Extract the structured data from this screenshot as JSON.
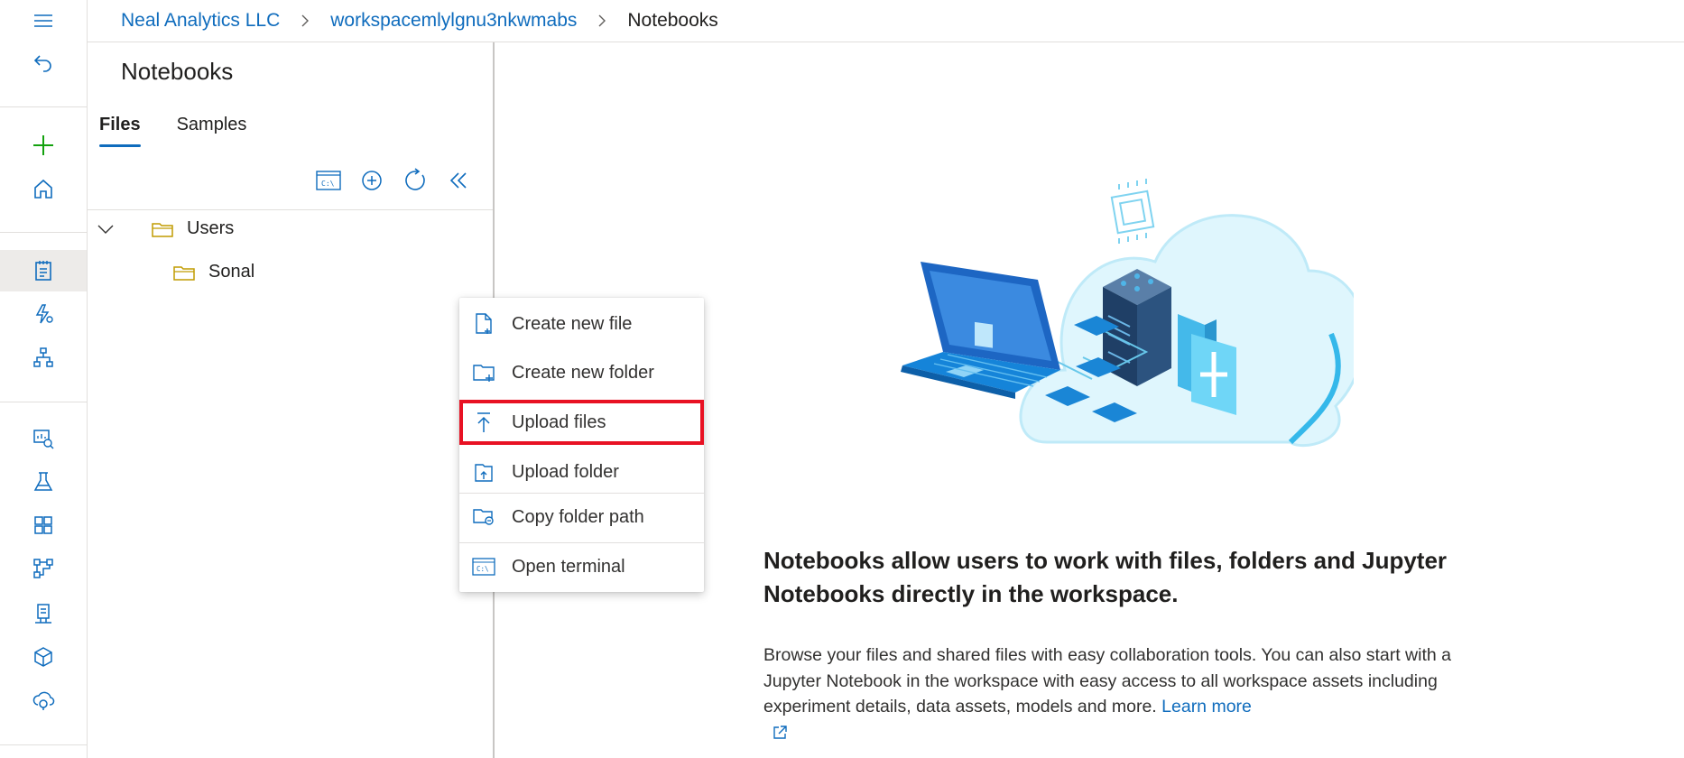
{
  "breadcrumb": {
    "org": "Neal Analytics LLC",
    "workspace": "workspacemlylgnu3nkwmabs",
    "current": "Notebooks"
  },
  "rail": {
    "icons": [
      "hamburger-icon",
      "back-icon",
      "plus-icon",
      "home-icon",
      "notebook-icon",
      "automl-icon",
      "designer-icon",
      "data-icon",
      "experiments-icon",
      "pipelines-icon",
      "models-icon",
      "endpoints-icon",
      "compute-icon",
      "linked-services-icon"
    ],
    "accent": "#0f6cbd",
    "plus_color": "#13a10e"
  },
  "panel": {
    "title": "Notebooks",
    "tabs": [
      {
        "label": "Files",
        "active": true
      },
      {
        "label": "Samples",
        "active": false
      }
    ],
    "toolbar": [
      "terminal-icon",
      "add-icon",
      "refresh-icon",
      "collapse-icon"
    ],
    "tree": [
      {
        "label": "Users",
        "expanded": true
      },
      {
        "label": "Sonal"
      }
    ]
  },
  "context_menu": {
    "items": [
      {
        "label": "Create new file",
        "icon": "new-file-icon"
      },
      {
        "label": "Create new folder",
        "icon": "new-folder-icon"
      },
      {
        "label": "Upload files",
        "icon": "upload-icon",
        "highlighted": true
      },
      {
        "label": "Upload folder",
        "icon": "upload-folder-icon"
      },
      {
        "label": "Copy folder path",
        "icon": "copy-path-icon"
      },
      {
        "label": "Open terminal",
        "icon": "terminal-icon"
      }
    ],
    "highlight_color": "#e81123"
  },
  "main": {
    "headline": "Notebooks allow users to work with files, folders and Jupyter Notebooks directly in the workspace.",
    "description": "Browse your files and shared files with easy collaboration tools. You can also start with a Jupyter Notebook in the workspace with easy access to all workspace assets including experiment details, data assets, models and more.",
    "learn_more": "Learn more"
  }
}
